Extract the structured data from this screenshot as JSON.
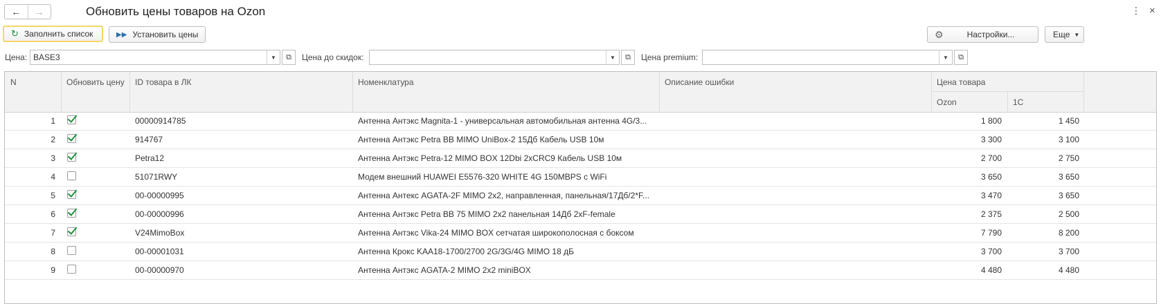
{
  "window": {
    "title": "Обновить цены товаров на Ozon"
  },
  "toolbar": {
    "fill_list_label": "Заполнить список",
    "set_prices_label": "Установить цены",
    "settings_label": "Настройки...",
    "more_label": "Еще"
  },
  "filters": {
    "price_label": "Цена:",
    "price_value": "BASE3",
    "pre_discount_label": "Цена до скидок:",
    "pre_discount_value": "",
    "premium_label": "Цена premium:",
    "premium_value": ""
  },
  "table": {
    "headers": {
      "n": "N",
      "update_price": "Обновить цену",
      "product_id": "ID товара в ЛК",
      "nomenclature": "Номенклатура",
      "error_description": "Описание ошибки",
      "price_group": "Цена товара",
      "ozon": "Ozon",
      "c1": "1С"
    },
    "rows": [
      {
        "n": "1",
        "checked": true,
        "id": "00000914785",
        "name": "Антенна Антэкс Magnita-1 - универсальная автомобильная антенна 4G/3...",
        "error": "",
        "ozon": "1 800",
        "c1": "1 450"
      },
      {
        "n": "2",
        "checked": true,
        "id": "914767",
        "name": "Антенна Антэкс Petra BB MIMO UniBox-2 15Дб Кабель USB 10м",
        "error": "",
        "ozon": "3 300",
        "c1": "3 100"
      },
      {
        "n": "3",
        "checked": true,
        "id": "Petra12",
        "name": "Антенна Антэкс Petra-12 MIMO BOX 12Dbi 2xCRC9 Кабель USB 10м",
        "error": "",
        "ozon": "2 700",
        "c1": "2 750"
      },
      {
        "n": "4",
        "checked": false,
        "id": "51071RWY",
        "name": "Модем внешний HUAWEI E5576-320 WHITE 4G 150MBPS с WiFi",
        "error": "",
        "ozon": "3 650",
        "c1": "3 650"
      },
      {
        "n": "5",
        "checked": true,
        "id": "00-00000995",
        "name": "Антенна Антекс AGATA-2F MIMO 2x2, направленная, панельная/17Дб/2*F...",
        "error": "",
        "ozon": "3 470",
        "c1": "3 650"
      },
      {
        "n": "6",
        "checked": true,
        "id": "00-00000996",
        "name": "Антенна Антэкс Petra BB 75 MIMO 2x2 панельная 14Дб 2xF-female",
        "error": "",
        "ozon": "2 375",
        "c1": "2 500"
      },
      {
        "n": "7",
        "checked": true,
        "id": "V24MimoBox",
        "name": "Антенна Антэкс Vika-24 MIMO BOX сетчатая широкополосная с боксом",
        "error": "",
        "ozon": "7 790",
        "c1": "8 200"
      },
      {
        "n": "8",
        "checked": false,
        "id": "00-00001031",
        "name": "Антенна Крокс KAA18-1700/2700 2G/3G/4G MIMO 18 дБ",
        "error": "",
        "ozon": "3 700",
        "c1": "3 700"
      },
      {
        "n": "9",
        "checked": false,
        "id": "00-00000970",
        "name": "Антенна Антэкс AGATA-2 MIMO 2x2 miniBOX",
        "error": "",
        "ozon": "4 480",
        "c1": "4 480"
      }
    ]
  },
  "colors": {
    "primary_border": "#f5d768",
    "check_green": "#1f8f3a",
    "header_bg": "#f2f2f2"
  }
}
